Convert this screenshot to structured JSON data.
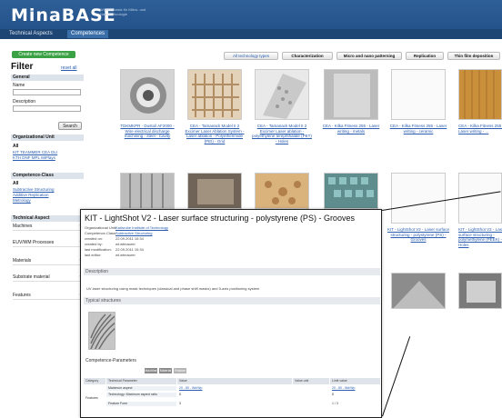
{
  "app": {
    "logo": "MinaBASE",
    "tagline": "Wissensbasis für Mikro- und Nanotechnologie"
  },
  "nav": {
    "tabs": [
      "Technical Aspects",
      "Competences"
    ]
  },
  "sidebar": {
    "create_button": "Create new Competence",
    "filter_title": "Filter",
    "reset_link": "reset all",
    "general": {
      "header": "General",
      "name_label": "Name",
      "description_label": "Description",
      "search_button": "Search"
    },
    "org_unit": {
      "header": "Organizational Unit",
      "all": "All",
      "links": [
        "KIT TEAMMER CEA DLI",
        "KTH DNF MPL MiPlays"
      ]
    },
    "competence_class": {
      "header": "Competence-Class",
      "all": "All",
      "links": [
        "Subtractive Structuring",
        "Additive Replication",
        "Metrology"
      ]
    },
    "technical_aspect": {
      "header": "Technical Aspect",
      "rows": [
        "Machines",
        "EUV/WM Processes",
        "Materials",
        "Substrate material",
        "Features"
      ]
    }
  },
  "filters": [
    "All technology types",
    "Characterization",
    "Micro and nano patterning",
    "Replication",
    "Thin film deposition"
  ],
  "cards_row1": [
    "TDKMKPR - Dustoil AF2000 - Wire electrical discharge machining - steel - Cavity",
    "CEA - Tamanack Model II 2 Excimer Laser Ablation System - Laser ablation - Polyetherimide (PEI) - Grid",
    "CEA - Tamanack Model II 2 Excimer Laser ablation - polyethylene terephthalate (PET) - Holes",
    "CEA - Kilka Fitness 255 - Laser writing - metals",
    "CEA - Kilka Fitness 255 - Laser writing - ceramic",
    "CEA - Kilka Fitness 255 - Laser writing - ..."
  ],
  "cards_row2": [
    "",
    "",
    "",
    "",
    "KIT - LightShot V2 - Laser surface structuring - polystyrene (PS) - Grooves",
    "KIT - LightShot V2 - Laser surface structuring - polymethylene (PEEK) - Holes"
  ],
  "detail": {
    "title": "KIT - LightShot V2 - Laser surface structuring - polystyrene (PS) - Grooves",
    "meta": [
      {
        "key": "Organizational Unit:",
        "value": "Karlsruhe Institute of Technology"
      },
      {
        "key": "Competence-Class:",
        "value": "Subtractive Structuring"
      },
      {
        "key": "created on:",
        "value": "22.09.2011 10:34"
      },
      {
        "key": "created by:",
        "value": "wt.wtmaurer"
      },
      {
        "key": "last modification:",
        "value": "22.09.2011 10:34"
      },
      {
        "key": "last editor:",
        "value": "wt.wtmaurer"
      }
    ],
    "description_header": "Description",
    "description_text": "UV laser structuring using mask techniques (classical and phase shift masks) and 5-axis positioning system",
    "image_header": "Typical structures",
    "params_header": "Competence-Parameters",
    "pills": [
      "Machine",
      "Material",
      "Feature"
    ],
    "table_headers": [
      "Category",
      "Technical Parameter",
      "Value",
      "Value unit",
      "Limit value"
    ],
    "table_rows": [
      [
        "Features",
        "Maximum aspect",
        "",
        "20 - 80 - Wd/Wp",
        "20 - 80 - Wd/Wp"
      ],
      [
        "",
        "Technology: Maximum aspect ratio",
        "8",
        "",
        "8"
      ],
      [
        "",
        "Feature Form",
        "3",
        "",
        "1 / 3"
      ]
    ]
  }
}
